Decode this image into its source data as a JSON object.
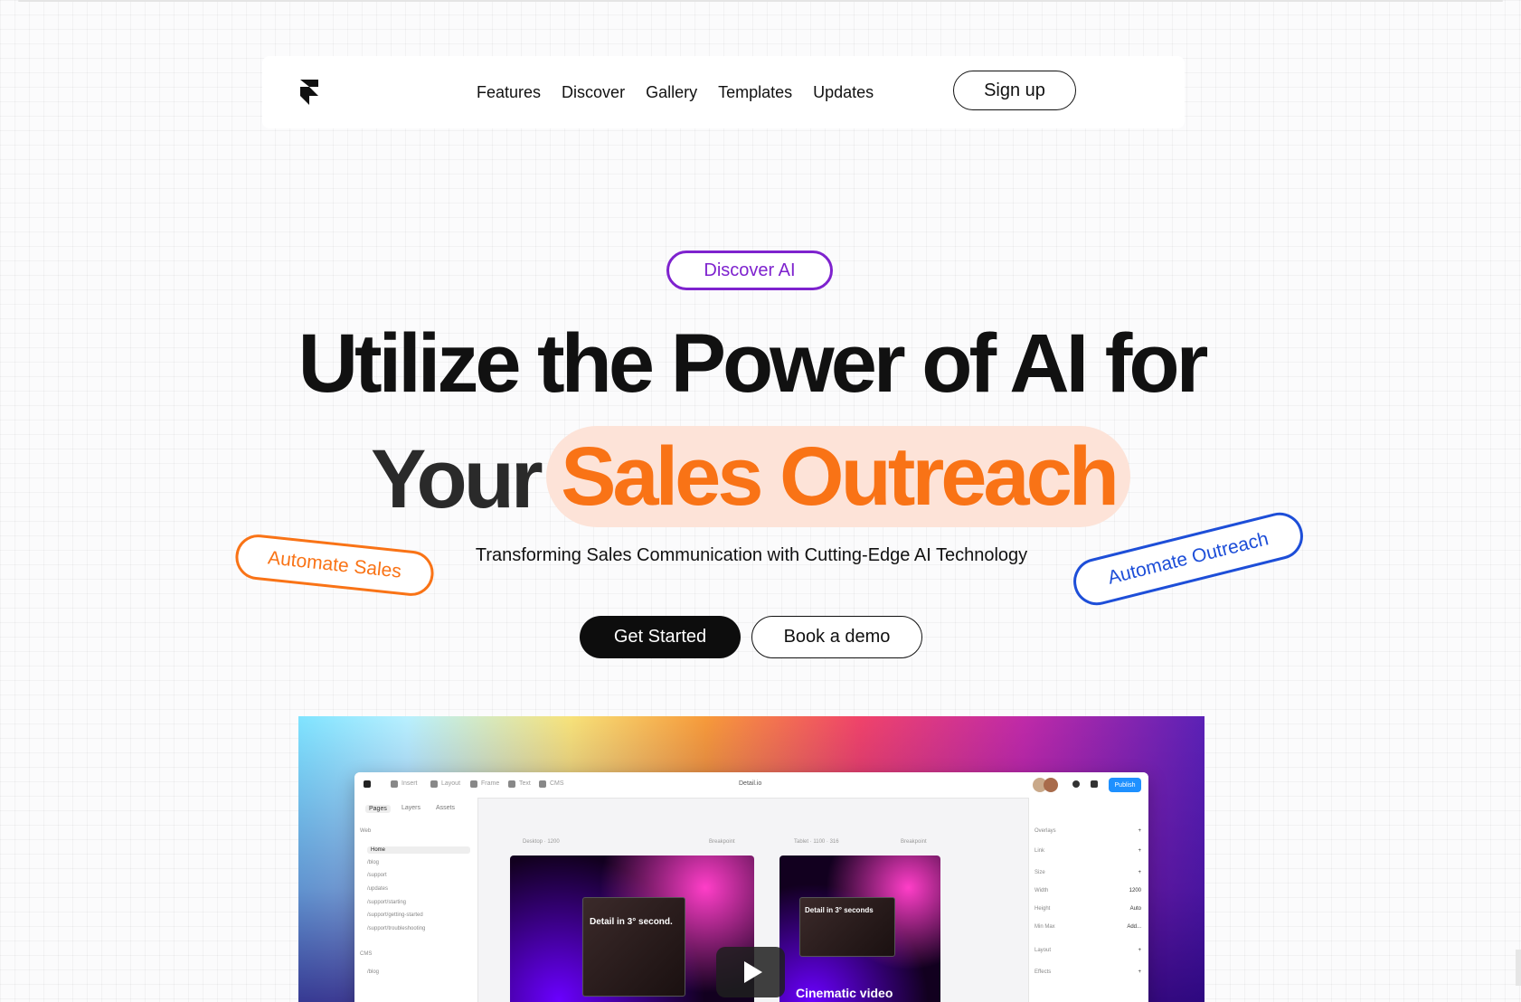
{
  "nav": {
    "links": [
      "Features",
      "Discover",
      "Gallery",
      "Templates",
      "Updates"
    ],
    "signup_label": "Sign up"
  },
  "hero": {
    "badge": "Discover AI",
    "headline_line1": "Utilize the Power of AI for",
    "headline_your": "Your",
    "headline_highlight": "Sales Outreach",
    "subtitle": "Transforming Sales Communication with Cutting-Edge AI Technology",
    "tag_left": "Automate Sales",
    "tag_right": "Automate Outreach",
    "primary_cta": "Get Started",
    "secondary_cta": "Book a demo"
  },
  "preview": {
    "toolbar": [
      "Insert",
      "Layout",
      "Frame",
      "Text",
      "CMS"
    ],
    "file_name": "Detail.io",
    "publish_label": "Publish",
    "panel_tabs": [
      "Pages",
      "Layers",
      "Assets"
    ],
    "pages_heading": "Web",
    "pages": [
      "Home",
      "/blog",
      "/support",
      "/updates",
      "/support/starting",
      "/support/getting-started",
      "/support/troubleshooting"
    ],
    "cms_heading": "CMS",
    "cms_items": [
      "/blog"
    ],
    "frame_left_label": "Desktop · 1200",
    "frame_left_breakpoint": "Breakpoint",
    "frame_right_label": "Tablet · 1100 · 316",
    "frame_right_breakpoint": "Breakpoint",
    "frame_left_caption": "Detail in 3° second.",
    "frame_right_caption": "Detail in 3° seconds",
    "frame_right_bottom": "Cinematic video",
    "right_panel": [
      {
        "label": "Overlays",
        "value": "+"
      },
      {
        "label": "Link",
        "value": "+"
      },
      {
        "label": "Size",
        "value": "+"
      },
      {
        "label": "Width",
        "value": "1200"
      },
      {
        "label": "Height",
        "value": "Auto"
      },
      {
        "label": "Min Max",
        "value": "Add..."
      },
      {
        "label": "Layout",
        "value": "+"
      },
      {
        "label": "Effects",
        "value": "+"
      }
    ]
  },
  "colors": {
    "accent_purple": "#7e22ce",
    "accent_orange": "#f97316",
    "accent_blue": "#1d4ed8",
    "highlight_bg": "#fde3d8",
    "cta_bg": "#0d0d0d"
  },
  "icons": [
    "framer-logo-icon",
    "play-icon"
  ]
}
